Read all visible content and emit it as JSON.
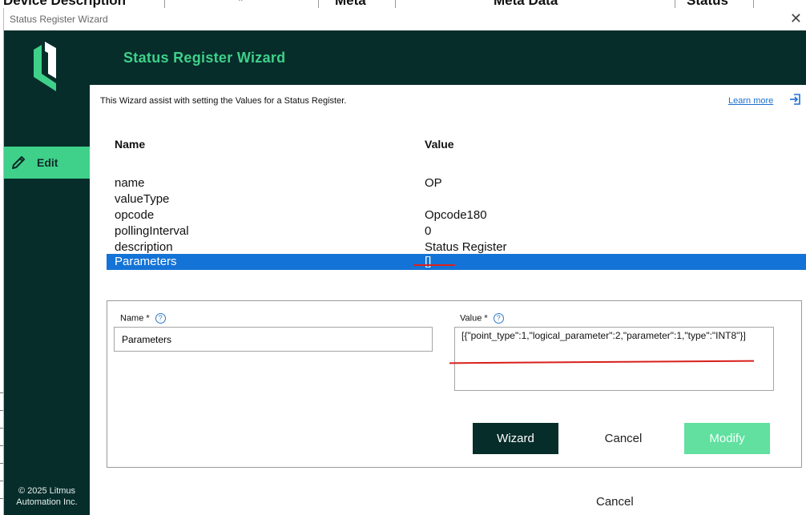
{
  "background_header": {
    "col1": "Device Description",
    "col2": "*",
    "col3": "Meta",
    "col4": "Meta Data",
    "col5": "Status"
  },
  "window": {
    "title": "Status Register Wizard",
    "close_icon": "close-icon"
  },
  "sidebar": {
    "logo_icon": "litmus-logo-icon",
    "edit_label": "Edit",
    "edit_icon": "pencil-icon",
    "copyright_line1": "© 2025 Litmus",
    "copyright_line2": "Automation Inc."
  },
  "header": {
    "title": "Status Register Wizard"
  },
  "intro": {
    "text": "This Wizard assist with setting the Values for a Status Register.",
    "learn_more": "Learn more",
    "learn_more_icon": "external-link-icon"
  },
  "table": {
    "columns": [
      "Name",
      "Value"
    ],
    "rows": [
      {
        "name": "name",
        "value": "OP"
      },
      {
        "name": "valueType",
        "value": ""
      },
      {
        "name": "opcode",
        "value": "Opcode180"
      },
      {
        "name": "pollingInterval",
        "value": "0"
      },
      {
        "name": "description",
        "value": "Status Register"
      },
      {
        "name": "Parameters",
        "value": "[]"
      }
    ]
  },
  "form": {
    "name_label": "Name *",
    "name_value": "Parameters",
    "value_label": "Value *",
    "value_text": "[{\"point_type\":1,\"logical_parameter\":2,\"parameter\":1,\"type\":\"INT8\"}]",
    "help_icon": "help-icon",
    "wizard_button": "Wizard",
    "cancel_button": "Cancel",
    "modify_button": "Modify"
  },
  "footer": {
    "cancel": "Cancel"
  },
  "colors": {
    "dark_green": "#062d2a",
    "accent_green": "#3fd08a",
    "selection_blue": "#1473d6",
    "annotation_red": "#e0201a"
  }
}
